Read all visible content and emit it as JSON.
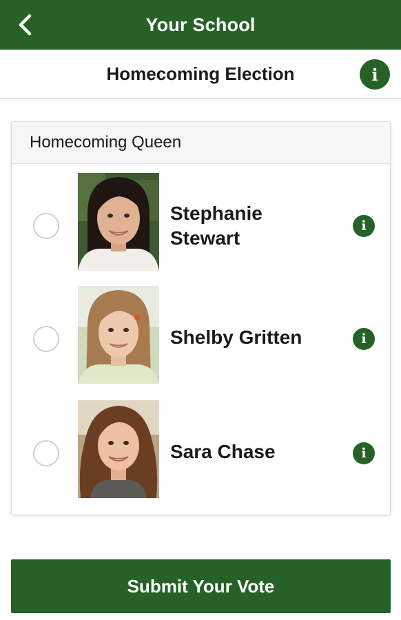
{
  "app_bar": {
    "title": "Your School",
    "back_icon": "chevron-left-icon",
    "color": "#266227"
  },
  "sub_header": {
    "title": "Homecoming Election",
    "info_icon": "info-icon",
    "info_glyph": "i"
  },
  "category": {
    "title": "Homecoming Queen",
    "candidates": [
      {
        "name": "Stephanie Stewart",
        "info_glyph": "i",
        "selected": false
      },
      {
        "name": "Shelby Gritten",
        "info_glyph": "i",
        "selected": false
      },
      {
        "name": "Sara Chase",
        "info_glyph": "i",
        "selected": false
      }
    ]
  },
  "submit": {
    "label": "Submit Your Vote"
  }
}
